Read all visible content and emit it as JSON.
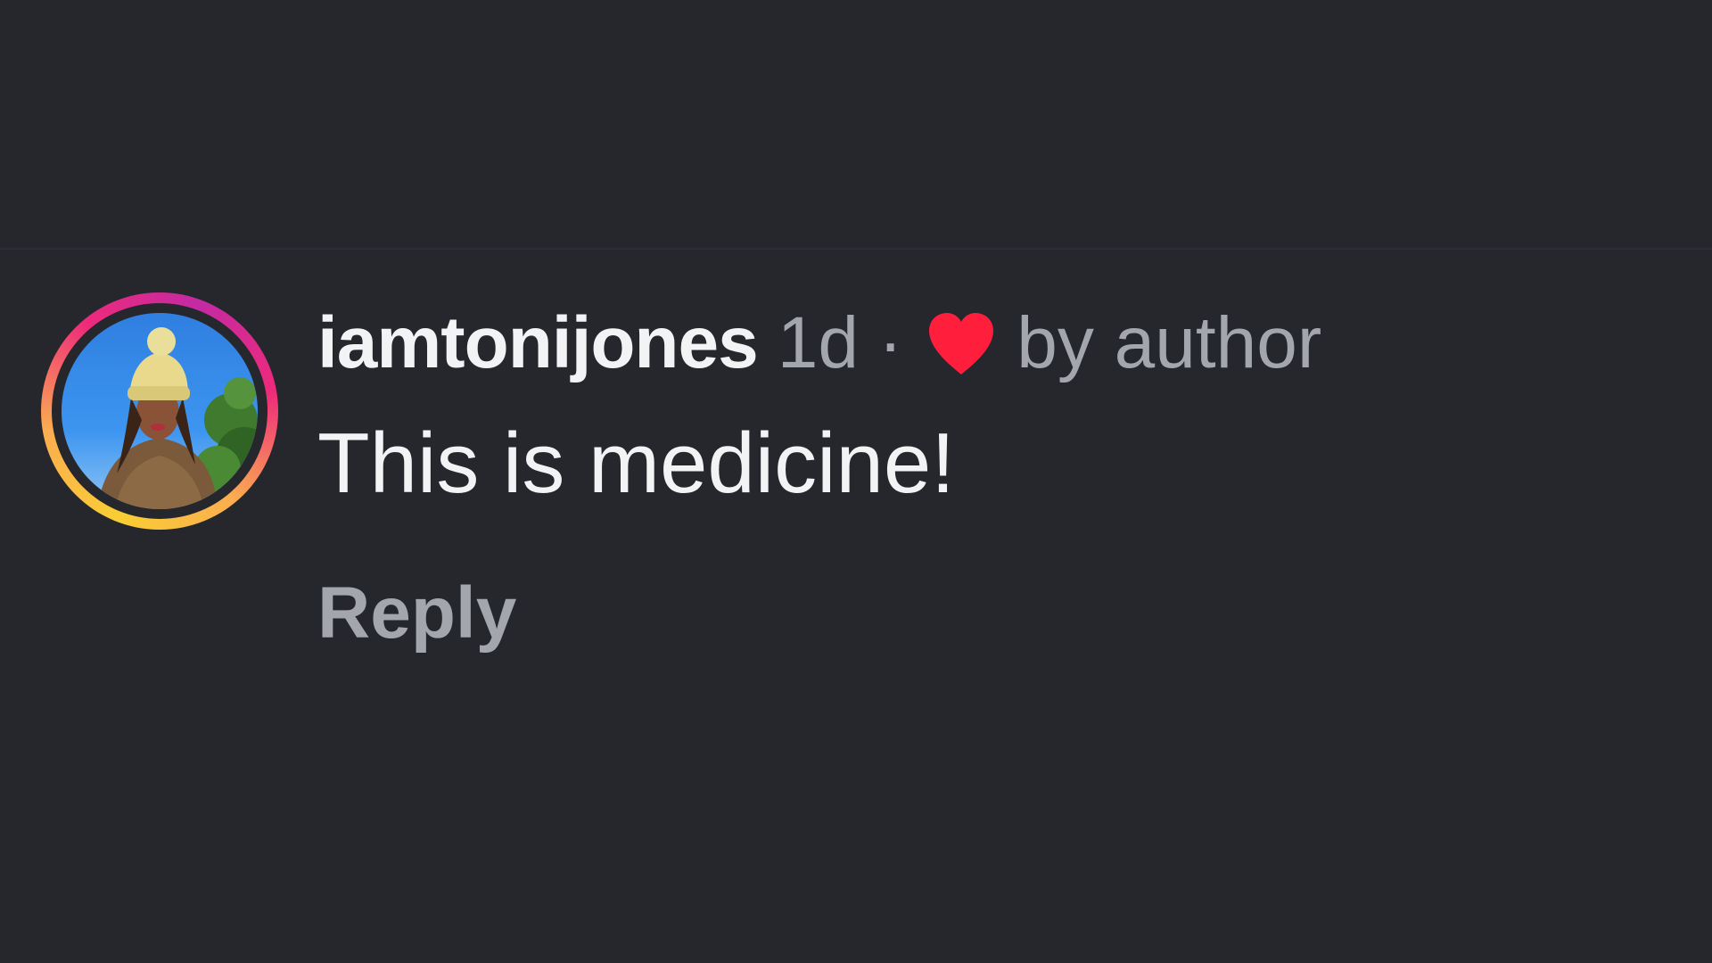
{
  "comment": {
    "username": "iamtonijones",
    "timestamp": "1d",
    "separator": "·",
    "liked_by_label": "by author",
    "text": "This is medicine!",
    "reply_label": "Reply"
  },
  "icons": {
    "heart": "heart-icon",
    "avatar": "avatar"
  },
  "colors": {
    "background": "#25272d",
    "username": "#f2f3f5",
    "secondary_text": "#a4a6ad",
    "heart": "#ff1f3d",
    "story_ring": [
      "#f9ce34",
      "#ee2a7b",
      "#c32aa3"
    ]
  }
}
